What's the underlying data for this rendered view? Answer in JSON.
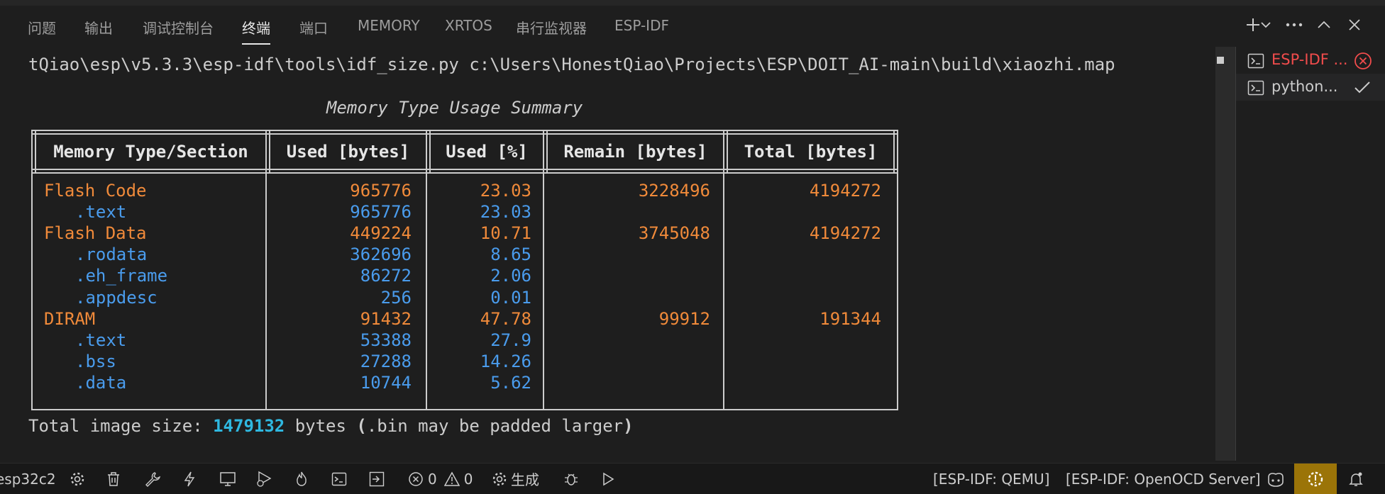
{
  "panel_tabs": [
    "问题",
    "输出",
    "调试控制台",
    "终端",
    "端口",
    "MEMORY",
    "XRTOS",
    "串行监视器",
    "ESP-IDF"
  ],
  "active_tab": "终端",
  "terminal": {
    "command_line": "tQiao\\esp\\v5.3.3\\esp-idf\\tools\\idf_size.py c:\\Users\\HonestQiao\\Projects\\ESP\\DOIT_AI-main\\build\\xiaozhi.map",
    "summary_title": "Memory Type Usage Summary",
    "table": {
      "headers": [
        "Memory Type/Section",
        "Used [bytes]",
        "Used [%]",
        "Remain [bytes]",
        "Total [bytes]"
      ],
      "rows": [
        {
          "name": "Flash Code",
          "used": "965776",
          "pct": "23.03",
          "remain": "3228496",
          "total": "4194272",
          "kind": "type"
        },
        {
          "name": ".text",
          "used": "965776",
          "pct": "23.03",
          "remain": "",
          "total": "",
          "kind": "section"
        },
        {
          "name": "Flash Data",
          "used": "449224",
          "pct": "10.71",
          "remain": "3745048",
          "total": "4194272",
          "kind": "type"
        },
        {
          "name": ".rodata",
          "used": "362696",
          "pct": "8.65",
          "remain": "",
          "total": "",
          "kind": "section"
        },
        {
          "name": ".eh_frame",
          "used": "86272",
          "pct": "2.06",
          "remain": "",
          "total": "",
          "kind": "section"
        },
        {
          "name": ".appdesc",
          "used": "256",
          "pct": "0.01",
          "remain": "",
          "total": "",
          "kind": "section"
        },
        {
          "name": "DIRAM",
          "used": "91432",
          "pct": "47.78",
          "remain": "99912",
          "total": "191344",
          "kind": "type"
        },
        {
          "name": ".text",
          "used": "53388",
          "pct": "27.9",
          "remain": "",
          "total": "",
          "kind": "section"
        },
        {
          "name": ".bss",
          "used": "27288",
          "pct": "14.26",
          "remain": "",
          "total": "",
          "kind": "section"
        },
        {
          "name": ".data",
          "used": "10744",
          "pct": "5.62",
          "remain": "",
          "total": "",
          "kind": "section"
        }
      ]
    },
    "total_prefix": "Total image size: ",
    "total_value": "1479132",
    "total_suffix_1": " bytes ",
    "total_paren_open": "(",
    "total_suffix_2": ".bin may be padded larger",
    "total_paren_close": ")"
  },
  "terminal_list": [
    {
      "label": "ESP-IDF ...",
      "state": "error"
    },
    {
      "label": "python...",
      "state": "success"
    }
  ],
  "status_bar": {
    "target": "esp32c2",
    "errors": "0",
    "warnings": "0",
    "build_label": "生成",
    "qemu": "[ESP-IDF: QEMU]",
    "openocd": "[ESP-IDF: OpenOCD Server]"
  },
  "colors": {
    "type_row": "#f08a3a",
    "section_row": "#4a9ced",
    "total_highlight": "#2fb8e0",
    "error": "#f14c4c",
    "warning_bg": "#9b7408"
  }
}
